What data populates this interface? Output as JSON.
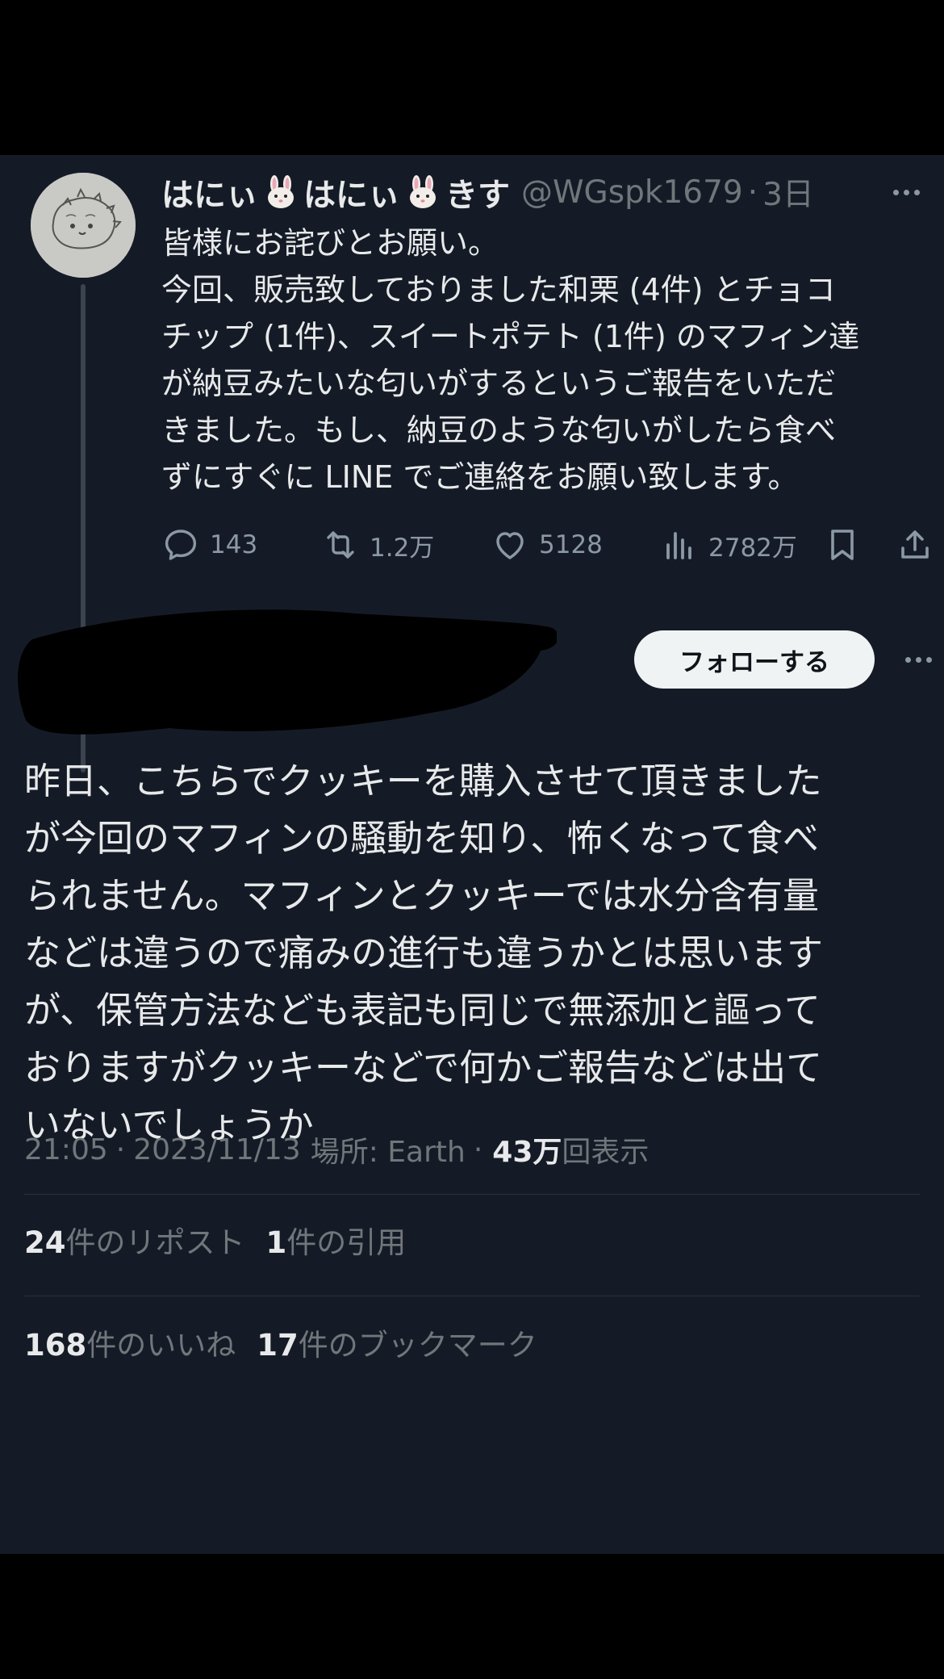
{
  "quoted_tweet": {
    "display_name": [
      "はにぃ",
      "はにぃ",
      "きす"
    ],
    "handle": "@WGspk1679",
    "age": "3日",
    "body_lines": [
      "皆様にお詫びとお願い。",
      "今回、販売致しておりました和栗 (4件) とチョコ",
      "チップ (1件)、スイートポテト (1件) のマフィン達",
      "が納豆みたいな匂いがするというご報告をいただ",
      "きました。もし、納豆のような匂いがしたら食べ",
      "ずにすぐに LINE でご連絡をお願い致します。"
    ],
    "actions": {
      "replies": "143",
      "reposts": "1.2万",
      "likes": "5128",
      "views": "2782万"
    }
  },
  "follow_button_label": "フォローする",
  "main_tweet": {
    "body_lines": [
      "昨日、こちらでクッキーを購入させて頂きました",
      "が今回のマフィンの騒動を知り、怖くなって食べ",
      "られません。マフィンとクッキーでは水分含有量",
      "などは違うので痛みの進行も違うかとは思います",
      "が、保管方法なども表記も同じで無添加と謳って",
      "おりますがクッキーなどで何かご報告などは出て",
      "いないでしょうか"
    ],
    "time": "21:05",
    "date": "2023/11/13",
    "location": "場所: Earth",
    "views_count": "43万",
    "views_label": "回表示",
    "separator": "·"
  },
  "stats": {
    "reposts_count": "24",
    "reposts_label": "件のリポスト",
    "quotes_count": "1",
    "quotes_label": "件の引用",
    "likes_count": "168",
    "likes_label": "件のいいね",
    "bookmarks_count": "17",
    "bookmarks_label": "件のブックマーク"
  },
  "icons": {
    "reply": "speech-bubble-icon",
    "repost": "repost-arrows-icon",
    "like": "heart-icon",
    "views": "bar-chart-icon",
    "bookmark": "bookmark-icon",
    "share": "share-icon",
    "more": "more-dots-icon",
    "emoji": "rabbit-face-emoji"
  },
  "colors": {
    "background": "#151b26",
    "text": "#e7e9ea",
    "secondary_text": "#71767b",
    "icon": "#8b98a5",
    "follow_button_bg": "#eff3f4"
  }
}
